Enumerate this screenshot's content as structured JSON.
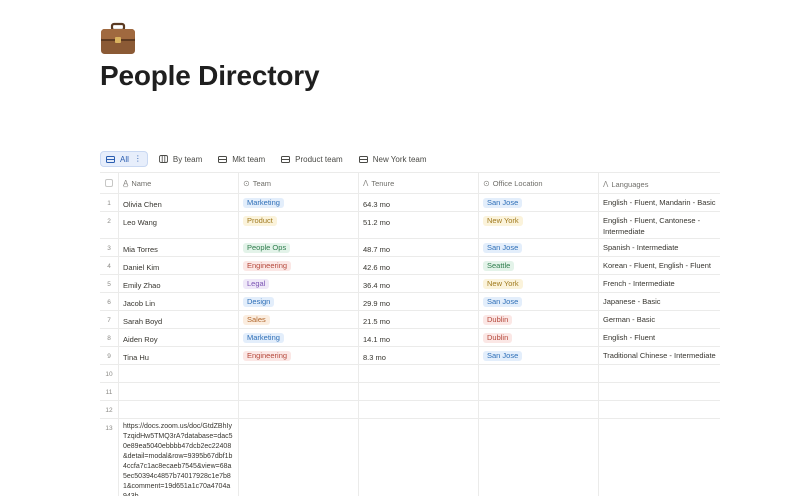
{
  "page": {
    "icon": "briefcase-icon",
    "title": "People Directory"
  },
  "views": [
    {
      "label": "All",
      "icon": "table-view-icon",
      "active": true
    },
    {
      "label": "By team",
      "icon": "board-view-icon",
      "active": false
    },
    {
      "label": "Mkt team",
      "icon": "table-view-icon",
      "active": false
    },
    {
      "label": "Product team",
      "icon": "table-view-icon",
      "active": false
    },
    {
      "label": "New York team",
      "icon": "table-view-icon",
      "active": false
    }
  ],
  "table": {
    "columns": [
      {
        "label": "Name",
        "icon": "text-property-icon"
      },
      {
        "label": "Team",
        "icon": "select-property-icon"
      },
      {
        "label": "Tenure",
        "icon": "formula-property-icon"
      },
      {
        "label": "Office Location",
        "icon": "select-property-icon"
      },
      {
        "label": "Languages",
        "icon": "formula-property-icon"
      }
    ],
    "rows": [
      {
        "num": "1",
        "name": "Olivia Chen",
        "team": "Marketing",
        "team_color": "blue",
        "tenure": "64.3 mo",
        "office": "San Jose",
        "office_color": "blue",
        "languages": "English - Fluent, Mandarin - Basic"
      },
      {
        "num": "2",
        "name": "Leo Wang",
        "team": "Product",
        "team_color": "yellow",
        "tenure": "51.2 mo",
        "office": "New York",
        "office_color": "yellow",
        "languages": "English - Fluent, Cantonese - Intermediate"
      },
      {
        "num": "3",
        "name": "Mia Torres",
        "team": "People Ops",
        "team_color": "green",
        "tenure": "48.7 mo",
        "office": "San Jose",
        "office_color": "blue",
        "languages": "Spanish - Intermediate"
      },
      {
        "num": "4",
        "name": "Daniel Kim",
        "team": "Engineering",
        "team_color": "red",
        "tenure": "42.6 mo",
        "office": "Seattle",
        "office_color": "green",
        "languages": "Korean - Fluent, English - Fluent"
      },
      {
        "num": "5",
        "name": "Emily Zhao",
        "team": "Legal",
        "team_color": "purple",
        "tenure": "36.4 mo",
        "office": "New York",
        "office_color": "yellow",
        "languages": "French - Intermediate"
      },
      {
        "num": "6",
        "name": "Jacob Lin",
        "team": "Design",
        "team_color": "blue",
        "tenure": "29.9 mo",
        "office": "San Jose",
        "office_color": "blue",
        "languages": "Japanese - Basic"
      },
      {
        "num": "7",
        "name": "Sarah Boyd",
        "team": "Sales",
        "team_color": "orange",
        "tenure": "21.5 mo",
        "office": "Dublin",
        "office_color": "red",
        "languages": "German - Basic"
      },
      {
        "num": "8",
        "name": "Aiden Roy",
        "team": "Marketing",
        "team_color": "blue",
        "tenure": "14.1 mo",
        "office": "Dublin",
        "office_color": "red",
        "languages": "English - Fluent"
      },
      {
        "num": "9",
        "name": "Tina Hu",
        "team": "Engineering",
        "team_color": "red",
        "tenure": "8.3 mo",
        "office": "San Jose",
        "office_color": "blue",
        "languages": "Traditional Chinese - Intermediate"
      }
    ],
    "empty_rows": [
      "10",
      "11",
      "12"
    ],
    "url_row": {
      "num": "13",
      "text": "https://docs.zoom.us/doc/GtdZBhIyTzqidHw5TMQ3rA?database=dac50e89ea5040ebbbb47dcb2ec22408&detail=modal&row=9395b67dbf1b4ccfa7c1ac8ecaeb7545&view=68a5ec50394c4857b74017928c1e7b81&comment=19d651a1c70a4704a943b"
    }
  }
}
